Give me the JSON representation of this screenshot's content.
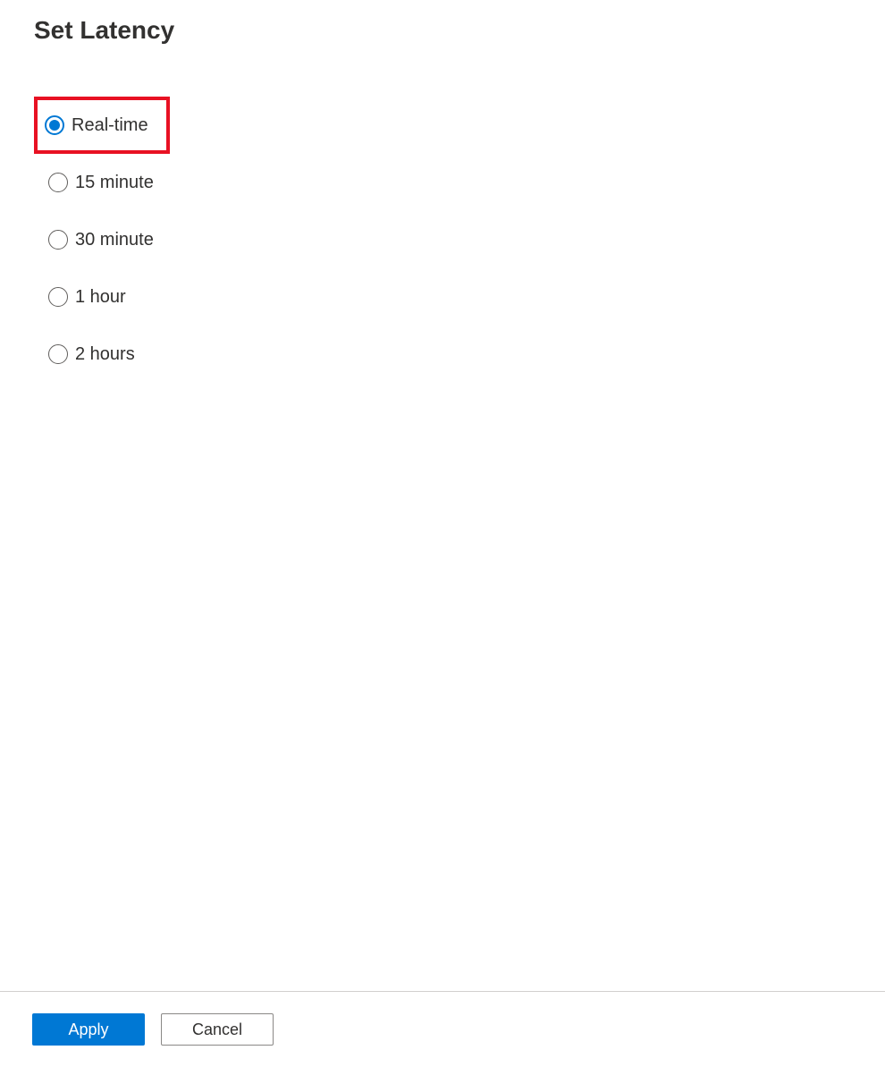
{
  "title": "Set Latency",
  "options": [
    {
      "label": "Real-time",
      "selected": true,
      "highlighted": true
    },
    {
      "label": "15 minute",
      "selected": false,
      "highlighted": false
    },
    {
      "label": "30 minute",
      "selected": false,
      "highlighted": false
    },
    {
      "label": "1 hour",
      "selected": false,
      "highlighted": false
    },
    {
      "label": "2 hours",
      "selected": false,
      "highlighted": false
    }
  ],
  "footer": {
    "apply_label": "Apply",
    "cancel_label": "Cancel"
  }
}
